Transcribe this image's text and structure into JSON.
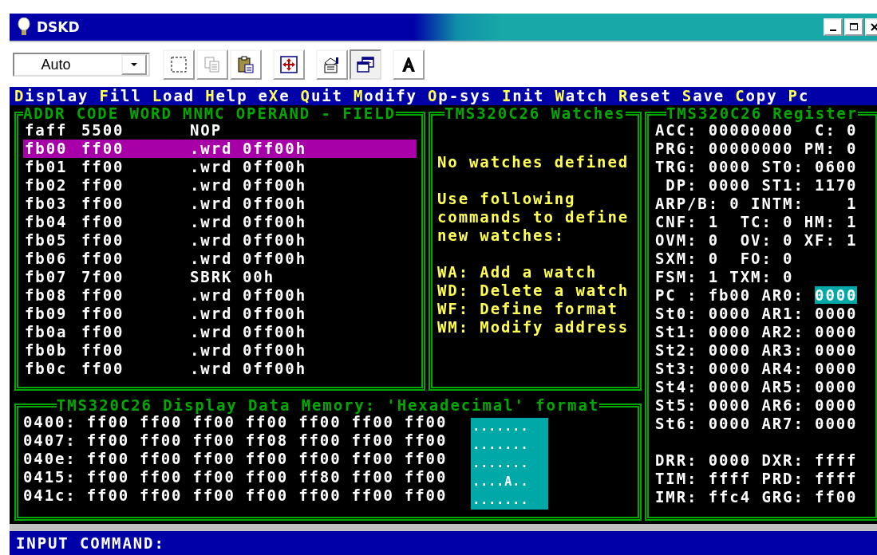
{
  "window": {
    "title": "DSKD"
  },
  "toolbar": {
    "combo": {
      "value": "Auto"
    },
    "buttons": [
      {
        "kind": "select",
        "pressed": false
      },
      {
        "kind": "copy",
        "pressed": false,
        "disabled": true
      },
      {
        "kind": "paste",
        "pressed": false
      },
      {
        "kind": "move",
        "pressed": false
      },
      {
        "kind": "properties",
        "pressed": false
      },
      {
        "kind": "windows",
        "pressed": true
      },
      {
        "kind": "font",
        "pressed": false
      }
    ]
  },
  "menu": [
    {
      "key": "D",
      "after": "isplay"
    },
    {
      "key": "F",
      "after": "ill"
    },
    {
      "key": "L",
      "after": "oad"
    },
    {
      "key": "H",
      "after": "elp"
    },
    {
      "before": "e",
      "key": "X",
      "after": "e"
    },
    {
      "key": "Q",
      "after": "uit"
    },
    {
      "key": "M",
      "after": "odify"
    },
    {
      "key": "O",
      "after": "p-sys"
    },
    {
      "key": "I",
      "after": "nit"
    },
    {
      "key": "W",
      "after": "atch"
    },
    {
      "key": "R",
      "after": "eset"
    },
    {
      "key": "S",
      "after": "ave"
    },
    {
      "key": "C",
      "after": "opy"
    },
    {
      "key": "P",
      "after": "c"
    }
  ],
  "code_panel": {
    "title": "ADDR CODE WORD MNMC OPERAND - FIELD",
    "rows": [
      {
        "addr": "faff",
        "code": "5500",
        "mnemonic": "NOP",
        "selected": false
      },
      {
        "addr": "fb00",
        "code": "ff00",
        "mnemonic": ".wrd",
        "operand": "0ff00h",
        "selected": true
      },
      {
        "addr": "fb01",
        "code": "ff00",
        "mnemonic": ".wrd",
        "operand": "0ff00h",
        "selected": false
      },
      {
        "addr": "fb02",
        "code": "ff00",
        "mnemonic": ".wrd",
        "operand": "0ff00h",
        "selected": false
      },
      {
        "addr": "fb03",
        "code": "ff00",
        "mnemonic": ".wrd",
        "operand": "0ff00h",
        "selected": false
      },
      {
        "addr": "fb04",
        "code": "ff00",
        "mnemonic": ".wrd",
        "operand": "0ff00h",
        "selected": false
      },
      {
        "addr": "fb05",
        "code": "ff00",
        "mnemonic": ".wrd",
        "operand": "0ff00h",
        "selected": false
      },
      {
        "addr": "fb06",
        "code": "ff00",
        "mnemonic": ".wrd",
        "operand": "0ff00h",
        "selected": false
      },
      {
        "addr": "fb07",
        "code": "7f00",
        "mnemonic": "SBRK",
        "operand": "00h",
        "selected": false
      },
      {
        "addr": "fb08",
        "code": "ff00",
        "mnemonic": ".wrd",
        "operand": "0ff00h",
        "selected": false
      },
      {
        "addr": "fb09",
        "code": "ff00",
        "mnemonic": ".wrd",
        "operand": "0ff00h",
        "selected": false
      },
      {
        "addr": "fb0a",
        "code": "ff00",
        "mnemonic": ".wrd",
        "operand": "0ff00h",
        "selected": false
      },
      {
        "addr": "fb0b",
        "code": "ff00",
        "mnemonic": ".wrd",
        "operand": "0ff00h",
        "selected": false
      },
      {
        "addr": "fb0c",
        "code": "ff00",
        "mnemonic": ".wrd",
        "operand": "0ff00h",
        "selected": false
      }
    ]
  },
  "watches_panel": {
    "title": "TMS320C26 Watches",
    "message": "No watches defined",
    "help": "Use following commands to define new watches:",
    "commands": [
      "WA: Add a watch",
      "WD: Delete a watch",
      "WF: Define format",
      "WM: Modify address"
    ]
  },
  "register_panel": {
    "title": "TMS320C26 Register",
    "lines": [
      {
        "text": "ACC: 00000000  C: 0"
      },
      {
        "text": "PRG: 00000000 PM: 0"
      },
      {
        "text": "TRG: 0000 ST0: 0600"
      },
      {
        "text": " DP: 0000 ST1: 1170"
      },
      {
        "text": "ARP/B: 0 INTM:    1"
      },
      {
        "text": "CNF: 1  TC: 0 HM: 1"
      },
      {
        "text": "OVM: 0  OV: 0 XF: 1"
      },
      {
        "text": "SXM: 0  FO: 0"
      },
      {
        "text": "FSM: 1 TXM: 0"
      },
      {
        "text": "PC : fb00 AR0: ",
        "cursor": "0000"
      },
      {
        "text": "St0: 0000 AR1: 0000"
      },
      {
        "text": "St1: 0000 AR2: 0000"
      },
      {
        "text": "St2: 0000 AR3: 0000"
      },
      {
        "text": "St3: 0000 AR4: 0000"
      },
      {
        "text": "St4: 0000 AR5: 0000"
      },
      {
        "text": "St5: 0000 AR6: 0000"
      },
      {
        "text": "St6: 0000 AR7: 0000"
      }
    ],
    "peripheral_lines": [
      {
        "text": "DRR: 0000 DXR: ffff"
      },
      {
        "text": "TIM: ffff PRD: ffff"
      },
      {
        "text": "IMR: ffc4 GRG: ff00"
      }
    ]
  },
  "memory_panel": {
    "title": "TMS320C26 Display Data Memory: 'Hexadecimal' format",
    "rows": [
      {
        "addr": "0400:",
        "words": [
          "ff00",
          "ff00",
          "ff00",
          "ff00",
          "ff00",
          "ff00",
          "ff00"
        ],
        "ascii": "......."
      },
      {
        "addr": "0407:",
        "words": [
          "ff00",
          "ff00",
          "ff00",
          "ff08",
          "ff00",
          "ff00",
          "ff00"
        ],
        "ascii": "......."
      },
      {
        "addr": "040e:",
        "words": [
          "ff00",
          "ff00",
          "ff00",
          "ff00",
          "ff00",
          "ff00",
          "ff00"
        ],
        "ascii": "......."
      },
      {
        "addr": "0415:",
        "words": [
          "ff00",
          "ff00",
          "ff00",
          "ff00",
          "ff80",
          "ff00",
          "ff00"
        ],
        "ascii": "....A.."
      },
      {
        "addr": "041c:",
        "words": [
          "ff00",
          "ff00",
          "ff00",
          "ff00",
          "ff00",
          "ff00",
          "ff00"
        ],
        "ascii": "......."
      }
    ]
  },
  "command_bar": {
    "prompt": "INPUT COMMAND:"
  }
}
